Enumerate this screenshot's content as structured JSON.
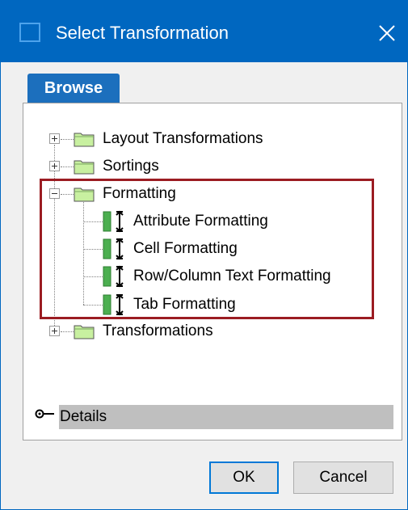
{
  "window": {
    "title": "Select Transformation"
  },
  "tabs": [
    {
      "label": "Browse"
    }
  ],
  "tree": [
    {
      "label": "Layout Transformations",
      "expanded": false
    },
    {
      "label": "Sortings",
      "expanded": false
    },
    {
      "label": "Formatting",
      "expanded": true,
      "children": [
        {
          "label": "Attribute Formatting"
        },
        {
          "label": "Cell Formatting"
        },
        {
          "label": "Row/Column Text Formatting"
        },
        {
          "label": "Tab Formatting"
        }
      ]
    },
    {
      "label": "Transformations",
      "expanded": false
    }
  ],
  "details": {
    "label": "Details"
  },
  "buttons": {
    "ok_label": "OK",
    "cancel_label": "Cancel"
  },
  "colors": {
    "titlebar": "#0067c0",
    "tab": "#1c6fbd",
    "highlight_border": "#9b1c22",
    "folder": "#c8f0a0",
    "format_icon_green": "#4caf50"
  },
  "icons": {
    "title": "window-icon",
    "close": "close-icon",
    "folder": "folder-icon",
    "format": "formatting-icon",
    "details": "expand-details-icon"
  }
}
